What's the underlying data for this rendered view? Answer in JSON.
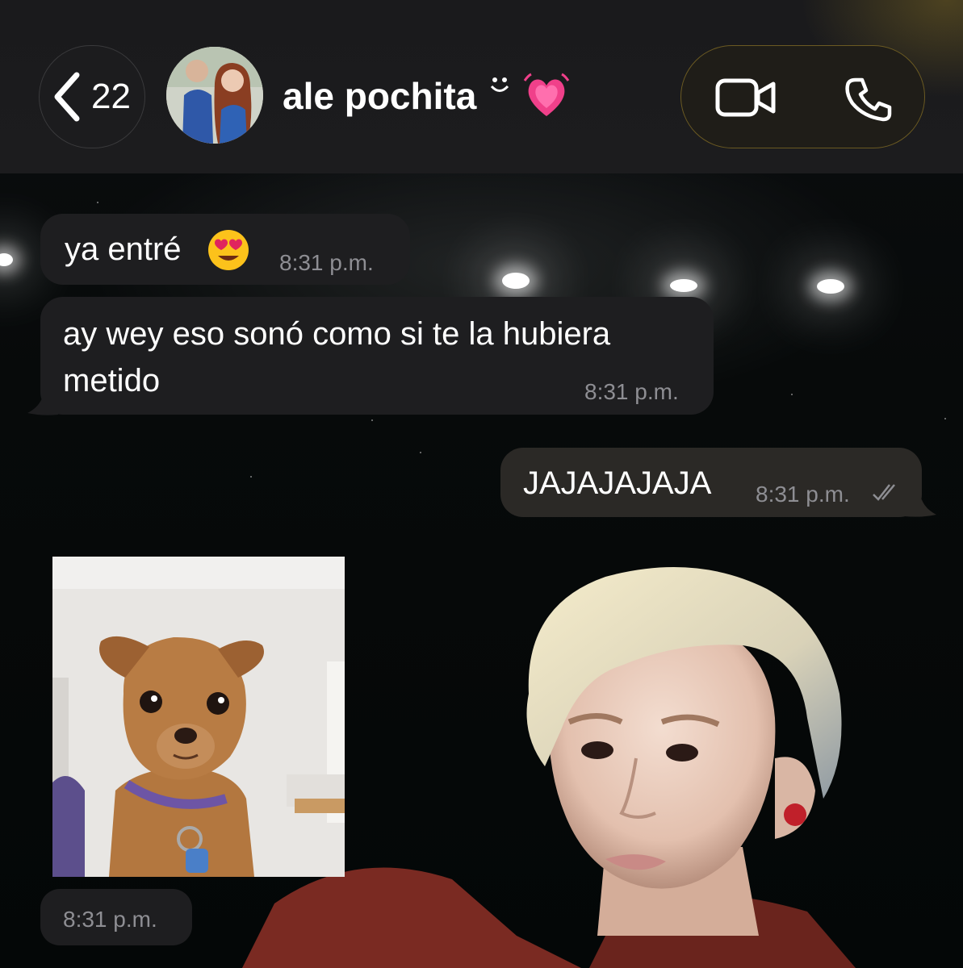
{
  "header": {
    "back_count": "22",
    "contact_name": "ale pochita",
    "name_emoji": "ᵕ̈",
    "heart_emoji": "growing-heart",
    "avatar": "avatar-photo",
    "video_icon": "video-camera-icon",
    "phone_icon": "phone-icon"
  },
  "messages": [
    {
      "direction": "incoming",
      "text": "ya entré",
      "emoji": "heart-eyes-emoji",
      "time": "8:31 p.m."
    },
    {
      "direction": "incoming",
      "lines": [
        "ay wey eso sonó como si te la hubiera",
        "metido"
      ],
      "time": "8:31 p.m."
    },
    {
      "direction": "outgoing",
      "text": "JAJAJAJAJA",
      "time": "8:31 p.m.",
      "status": "read-double-check"
    },
    {
      "direction": "incoming",
      "type": "image",
      "image": "dog-meme-photo",
      "time": "8:31 p.m."
    }
  ],
  "colors": {
    "header_bg": "#1c1c1e",
    "incoming_bubble": "#1e1e20",
    "outgoing_bubble": "#2b2926",
    "timestamp": "#8e8e93",
    "call_pill_border": "#6b5a22"
  }
}
